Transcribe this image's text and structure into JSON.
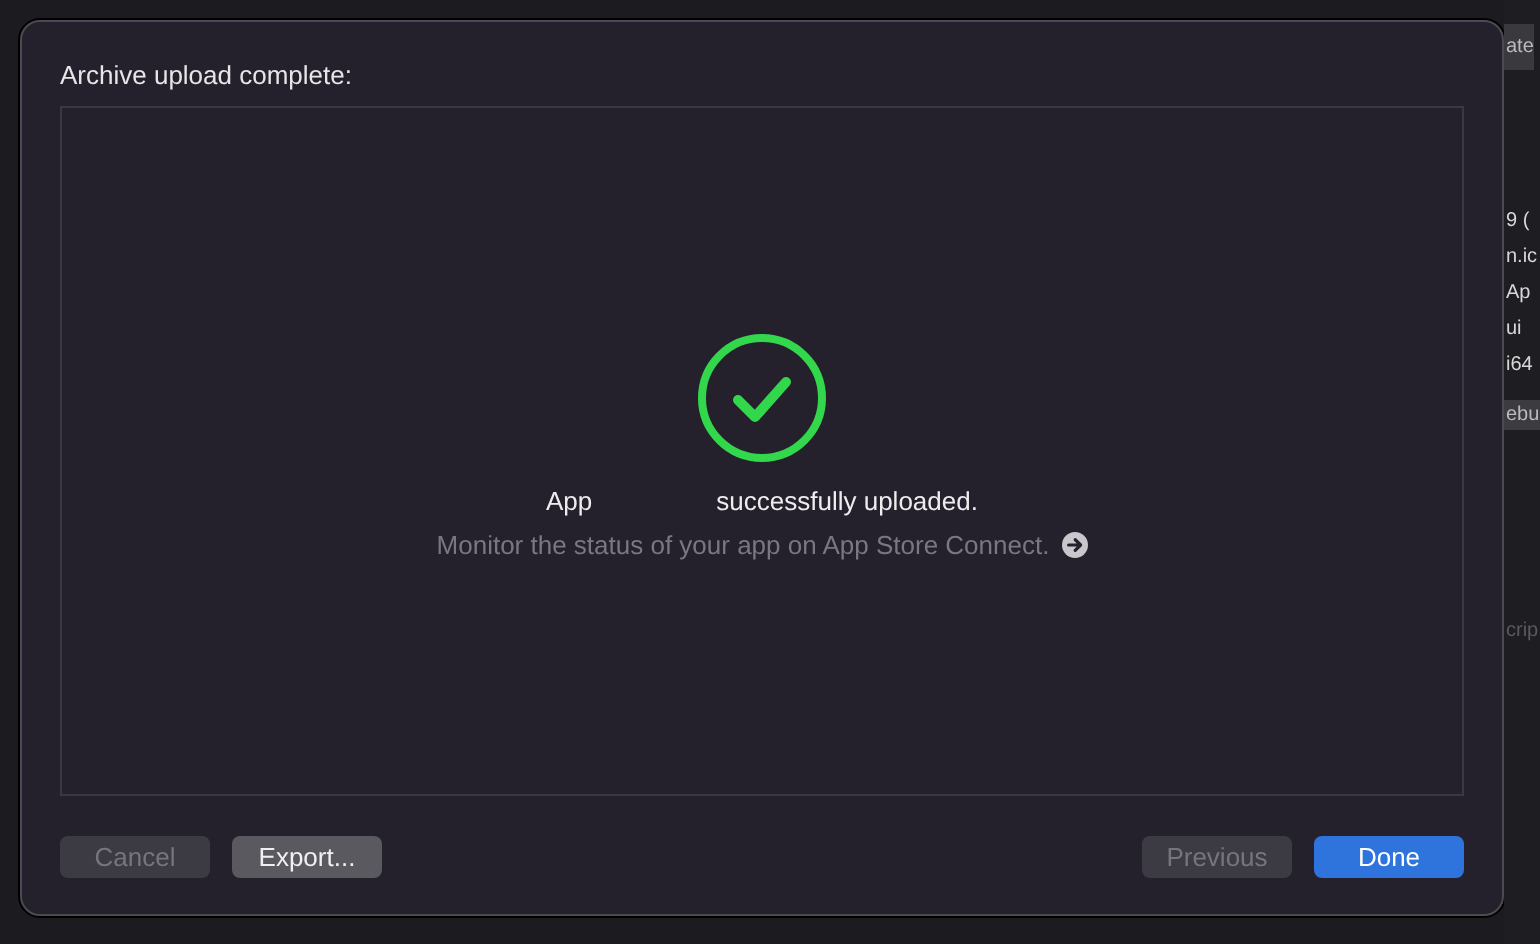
{
  "background_panel": {
    "items": [
      {
        "text": "ate",
        "kind": "header"
      },
      {
        "text": "9 (",
        "kind": "text"
      },
      {
        "text": "n.ic",
        "kind": "text"
      },
      {
        "text": "Ap",
        "kind": "text"
      },
      {
        "text": "ui",
        "kind": "text"
      },
      {
        "text": "i64",
        "kind": "text"
      },
      {
        "text": "ebu",
        "kind": "chip"
      },
      {
        "text": "crip",
        "kind": "faint"
      }
    ]
  },
  "dialog": {
    "title": "Archive upload complete:",
    "message": {
      "subject": "App",
      "status": "successfully uploaded."
    },
    "hint": "Monitor the status of your app on App Store Connect.",
    "left_buttons": [
      {
        "label": "Cancel",
        "disabled": true,
        "kind": "normal"
      },
      {
        "label": "Export...",
        "disabled": false,
        "kind": "normal"
      }
    ],
    "right_buttons": [
      {
        "label": "Previous",
        "disabled": true,
        "kind": "normal"
      },
      {
        "label": "Done",
        "disabled": false,
        "kind": "default"
      }
    ]
  }
}
